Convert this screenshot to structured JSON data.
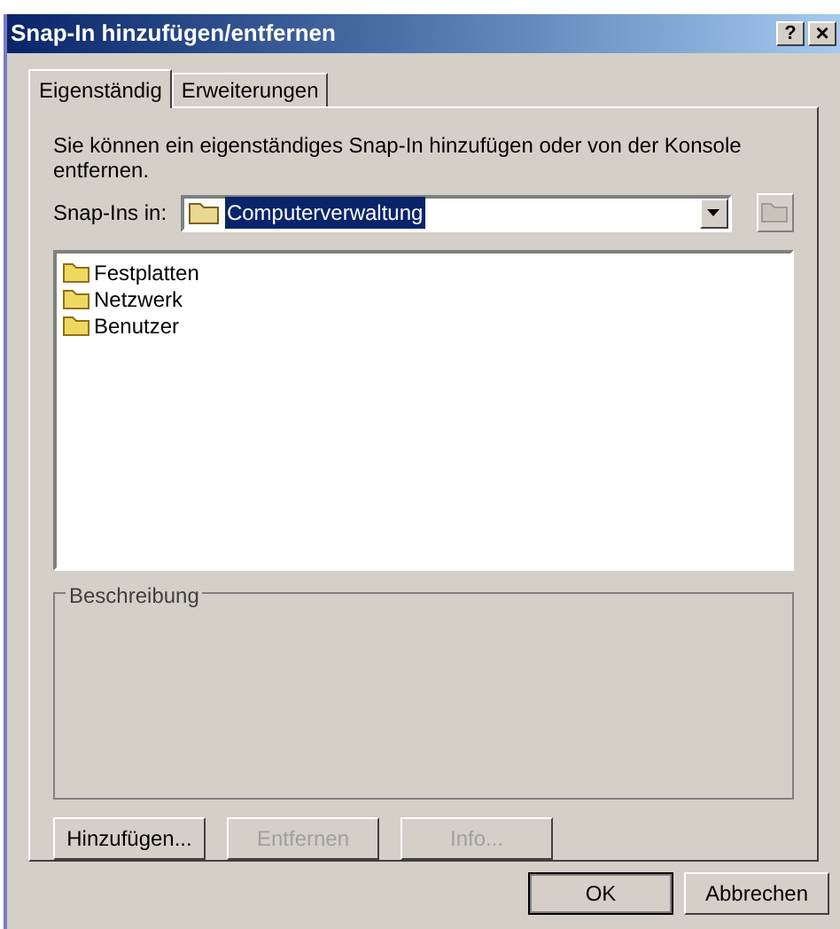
{
  "window": {
    "title": "Snap-In hinzufügen/entfernen",
    "help_button": "?",
    "close_button": "×"
  },
  "tabs": [
    {
      "label": "Eigenständig",
      "selected": true
    },
    {
      "label": "Erweiterungen",
      "selected": false
    }
  ],
  "intro": "Sie können ein eigenständiges Snap-In hinzufügen oder von der Konsole entfernen.",
  "snapins_in": {
    "label": "Snap-Ins in:",
    "value": "Computerverwaltung"
  },
  "snapins": [
    {
      "name": "Festplatten"
    },
    {
      "name": "Netzwerk"
    },
    {
      "name": "Benutzer"
    }
  ],
  "description": {
    "title": "Beschreibung"
  },
  "action_buttons": [
    {
      "label": "Hinzufügen...",
      "disabled": false
    },
    {
      "label": "Entfernen",
      "disabled": true
    },
    {
      "label": "Info...",
      "disabled": true
    }
  ],
  "dialog_buttons": [
    {
      "label": "OK",
      "default": true
    },
    {
      "label": "Abbrechen",
      "default": false
    }
  ]
}
